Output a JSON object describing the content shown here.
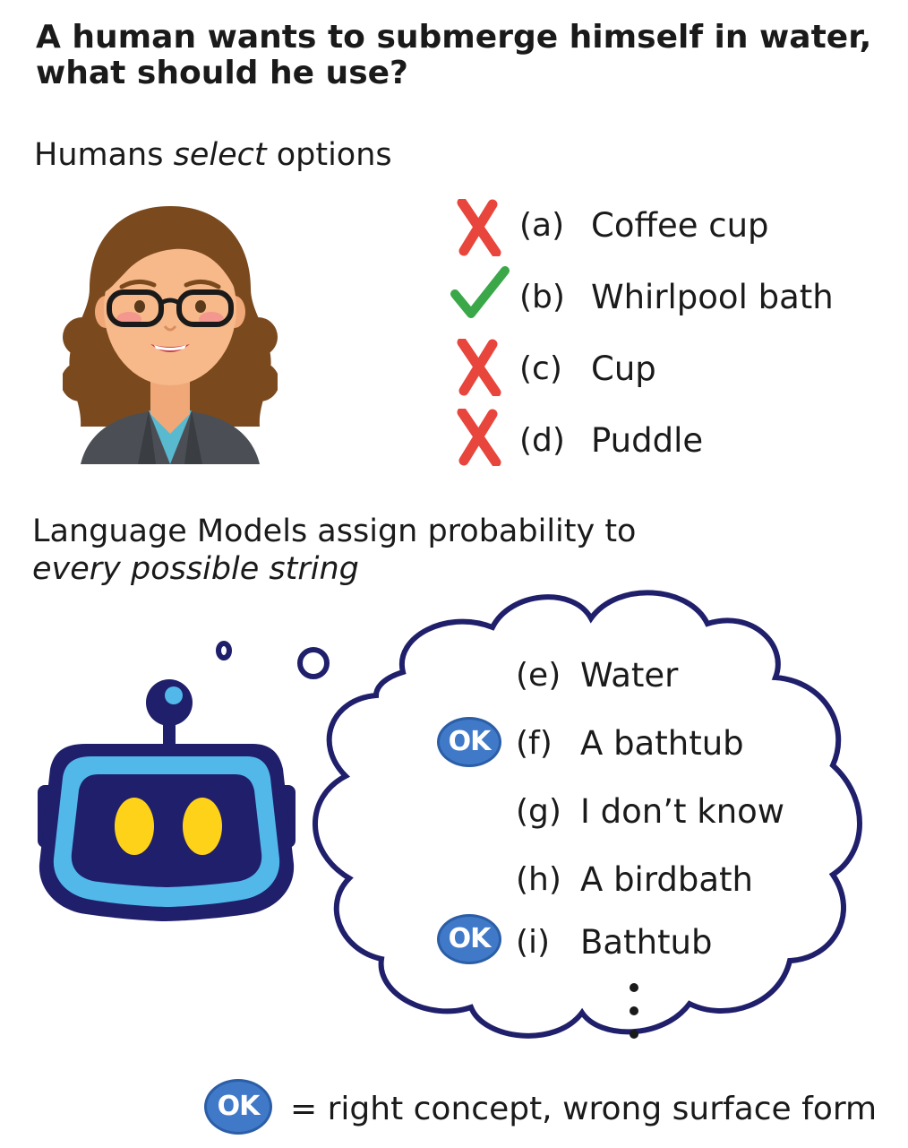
{
  "question": "A human wants to submerge himself in water, what should he use?",
  "humans_heading": {
    "pre": "Humans ",
    "em": "select",
    "post": " options"
  },
  "human_options": [
    {
      "letter": "(a)",
      "text": "Coffee cup",
      "mark": "x-icon"
    },
    {
      "letter": "(b)",
      "text": "Whirlpool bath",
      "mark": "check-icon"
    },
    {
      "letter": "(c)",
      "text": "Cup",
      "mark": "x-icon"
    },
    {
      "letter": "(d)",
      "text": "Puddle",
      "mark": "x-icon"
    }
  ],
  "lm_heading": {
    "line1": "Language Models assign probability to",
    "line2": "every possible string"
  },
  "lm_options": [
    {
      "letter": "(e)",
      "text": "Water",
      "ok": false
    },
    {
      "letter": "(f)",
      "text": "A bathtub",
      "ok": true
    },
    {
      "letter": "(g)",
      "text": "I don’t know",
      "ok": false
    },
    {
      "letter": "(h)",
      "text": "A birdbath",
      "ok": false
    },
    {
      "letter": "(i)",
      "text": "Bathtub",
      "ok": true
    }
  ],
  "ok_badge_label": "OK",
  "legend": {
    "badge": "OK",
    "text": "= right concept, wrong surface form"
  },
  "colors": {
    "x_mark": "#e8453c",
    "check_mark": "#3aa848",
    "ok_badge": "#3f79c8",
    "cloud_stroke": "#1f1f6b",
    "robot_light_blue": "#52b8ea",
    "robot_dark": "#1f1f6b",
    "robot_eyes": "#ffd21a"
  },
  "icons": {
    "woman": "woman-avatar-icon",
    "robot": "robot-icon",
    "cloud": "thought-cloud-icon"
  }
}
